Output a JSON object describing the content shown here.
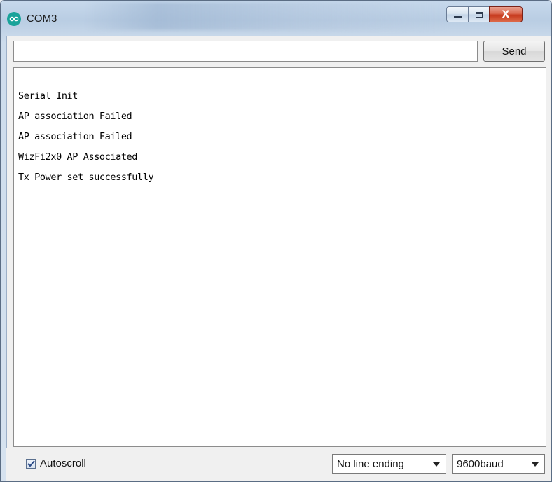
{
  "window": {
    "title": "COM3",
    "controls": {
      "minimize": "minimize",
      "maximize": "maximize",
      "close": "X"
    }
  },
  "toolbar": {
    "input_value": "",
    "send_label": "Send"
  },
  "output": {
    "lines": [
      "Serial Init",
      "AP association Failed",
      "AP association Failed",
      "WizFi2x0 AP Associated",
      "Tx Power set successfully"
    ]
  },
  "footer": {
    "autoscroll_label": "Autoscroll",
    "autoscroll_checked": true,
    "line_ending": "No line ending",
    "baud": "9600baud"
  },
  "colors": {
    "app_icon": "#19a39a",
    "close_button": "#c6391d",
    "title_bar": "#b9cde3"
  },
  "icons": {
    "app": "arduino-icon",
    "checkbox": "checkmark-icon",
    "dropdown": "chevron-down-icon"
  }
}
